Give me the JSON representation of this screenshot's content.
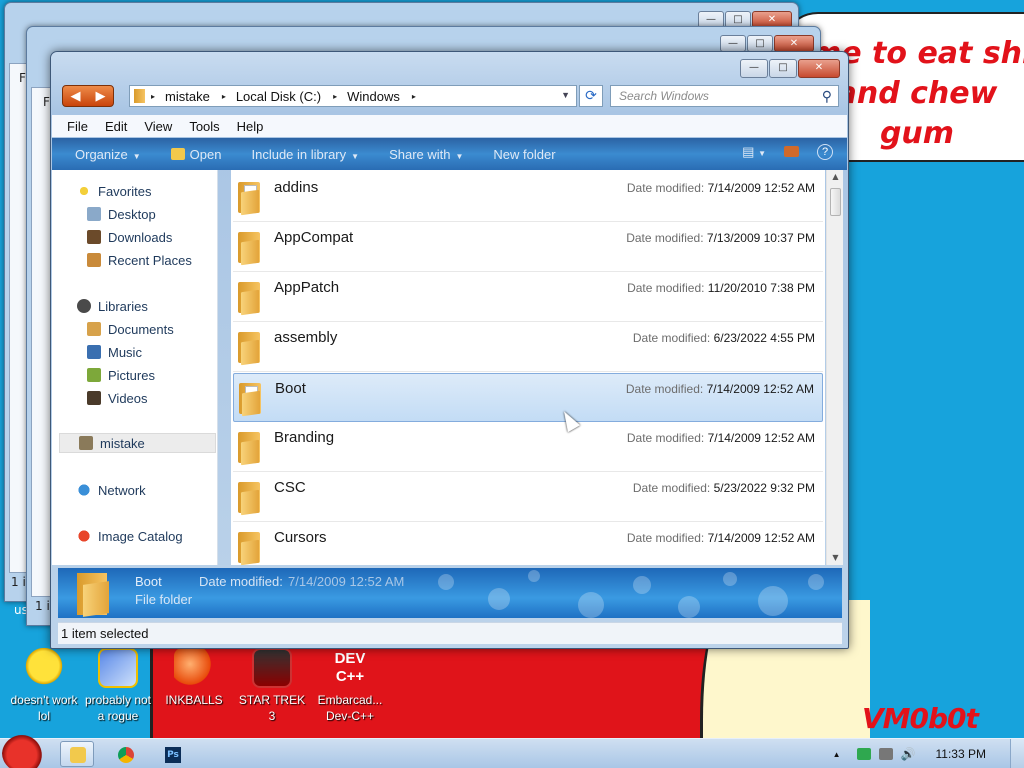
{
  "wallpaper": {
    "speech_lines": [
      "me to eat shit",
      "and chew",
      "gum"
    ],
    "logo_text": "VM0b0t",
    "colors": {
      "sky": "#17a3dc",
      "red": "#e0141a",
      "cream": "#fef7cc",
      "text_red": "#e2121a"
    }
  },
  "desktop_icons": [
    {
      "label": "doesn't work lol",
      "icon": "yahoo-messenger-icon"
    },
    {
      "label": "probably not a rogue",
      "icon": "program-icon"
    },
    {
      "label": "INKBALLS",
      "icon": "inkball-icon"
    },
    {
      "label": "STAR TREK 3",
      "icon": "star-trek-icon"
    },
    {
      "label": "Embarcad... Dev-C++",
      "icon": "dev-cpp-icon"
    }
  ],
  "dev_badge": "DEV C++",
  "background_windows": [
    {
      "menu_letter": "F",
      "status_text": "1 i",
      "label": "us"
    },
    {
      "menu_letter": "F",
      "status_text": "1 i"
    }
  ],
  "explorer": {
    "caption_buttons": {
      "minimize": "—",
      "maximize": "□",
      "close": "✕"
    },
    "nav_buttons": {
      "back": "◀",
      "forward": "▶"
    },
    "address": {
      "crumbs": [
        "mistake",
        "Local Disk (C:)",
        "Windows"
      ],
      "separator": "▸",
      "dropdown": "▼"
    },
    "refresh_glyph": "⟳",
    "search": {
      "placeholder": "Search Windows",
      "glyph": "⚲"
    },
    "menu": [
      "File",
      "Edit",
      "View",
      "Tools",
      "Help"
    ],
    "commands": {
      "organize": "Organize",
      "open": "Open",
      "include_in_library": "Include in library",
      "share_with": "Share with",
      "new_folder": "New folder",
      "dropdown_glyph": "▼",
      "views_glyph": "▤",
      "help_glyph": "?"
    },
    "nav_pane": {
      "favorites": {
        "label": "Favorites",
        "items": [
          "Desktop",
          "Downloads",
          "Recent Places"
        ]
      },
      "libraries": {
        "label": "Libraries",
        "items": [
          "Documents",
          "Music",
          "Pictures",
          "Videos"
        ]
      },
      "homegroup": "mistake",
      "network": "Network",
      "catalog": "Image Catalog"
    },
    "date_label": "Date modified:",
    "files": [
      {
        "name": "addins",
        "modified": "7/14/2009 12:52 AM"
      },
      {
        "name": "AppCompat",
        "modified": "7/13/2009 10:37 PM"
      },
      {
        "name": "AppPatch",
        "modified": "11/20/2010 7:38 PM"
      },
      {
        "name": "assembly",
        "modified": "6/23/2022 4:55 PM"
      },
      {
        "name": "Boot",
        "modified": "7/14/2009 12:52 AM",
        "selected": true
      },
      {
        "name": "Branding",
        "modified": "7/14/2009 12:52 AM"
      },
      {
        "name": "CSC",
        "modified": "5/23/2022 9:32 PM"
      },
      {
        "name": "Cursors",
        "modified": "7/14/2009 12:52 AM"
      }
    ],
    "scroll": {
      "up": "▲",
      "down": "▼"
    },
    "details": {
      "name": "Boot",
      "type": "File folder",
      "date_label": "Date modified:",
      "date_value": "7/14/2009 12:52 AM"
    },
    "status": "1 item selected"
  },
  "taskbar": {
    "buttons": [
      "explorer-taskbar-button",
      "chrome-taskbar-button",
      "photoshop-taskbar-button"
    ],
    "photoshop_glyph": "Ps",
    "tray_arrow": "▲",
    "clock": "11:33 PM",
    "volume_glyph": "🔊"
  }
}
